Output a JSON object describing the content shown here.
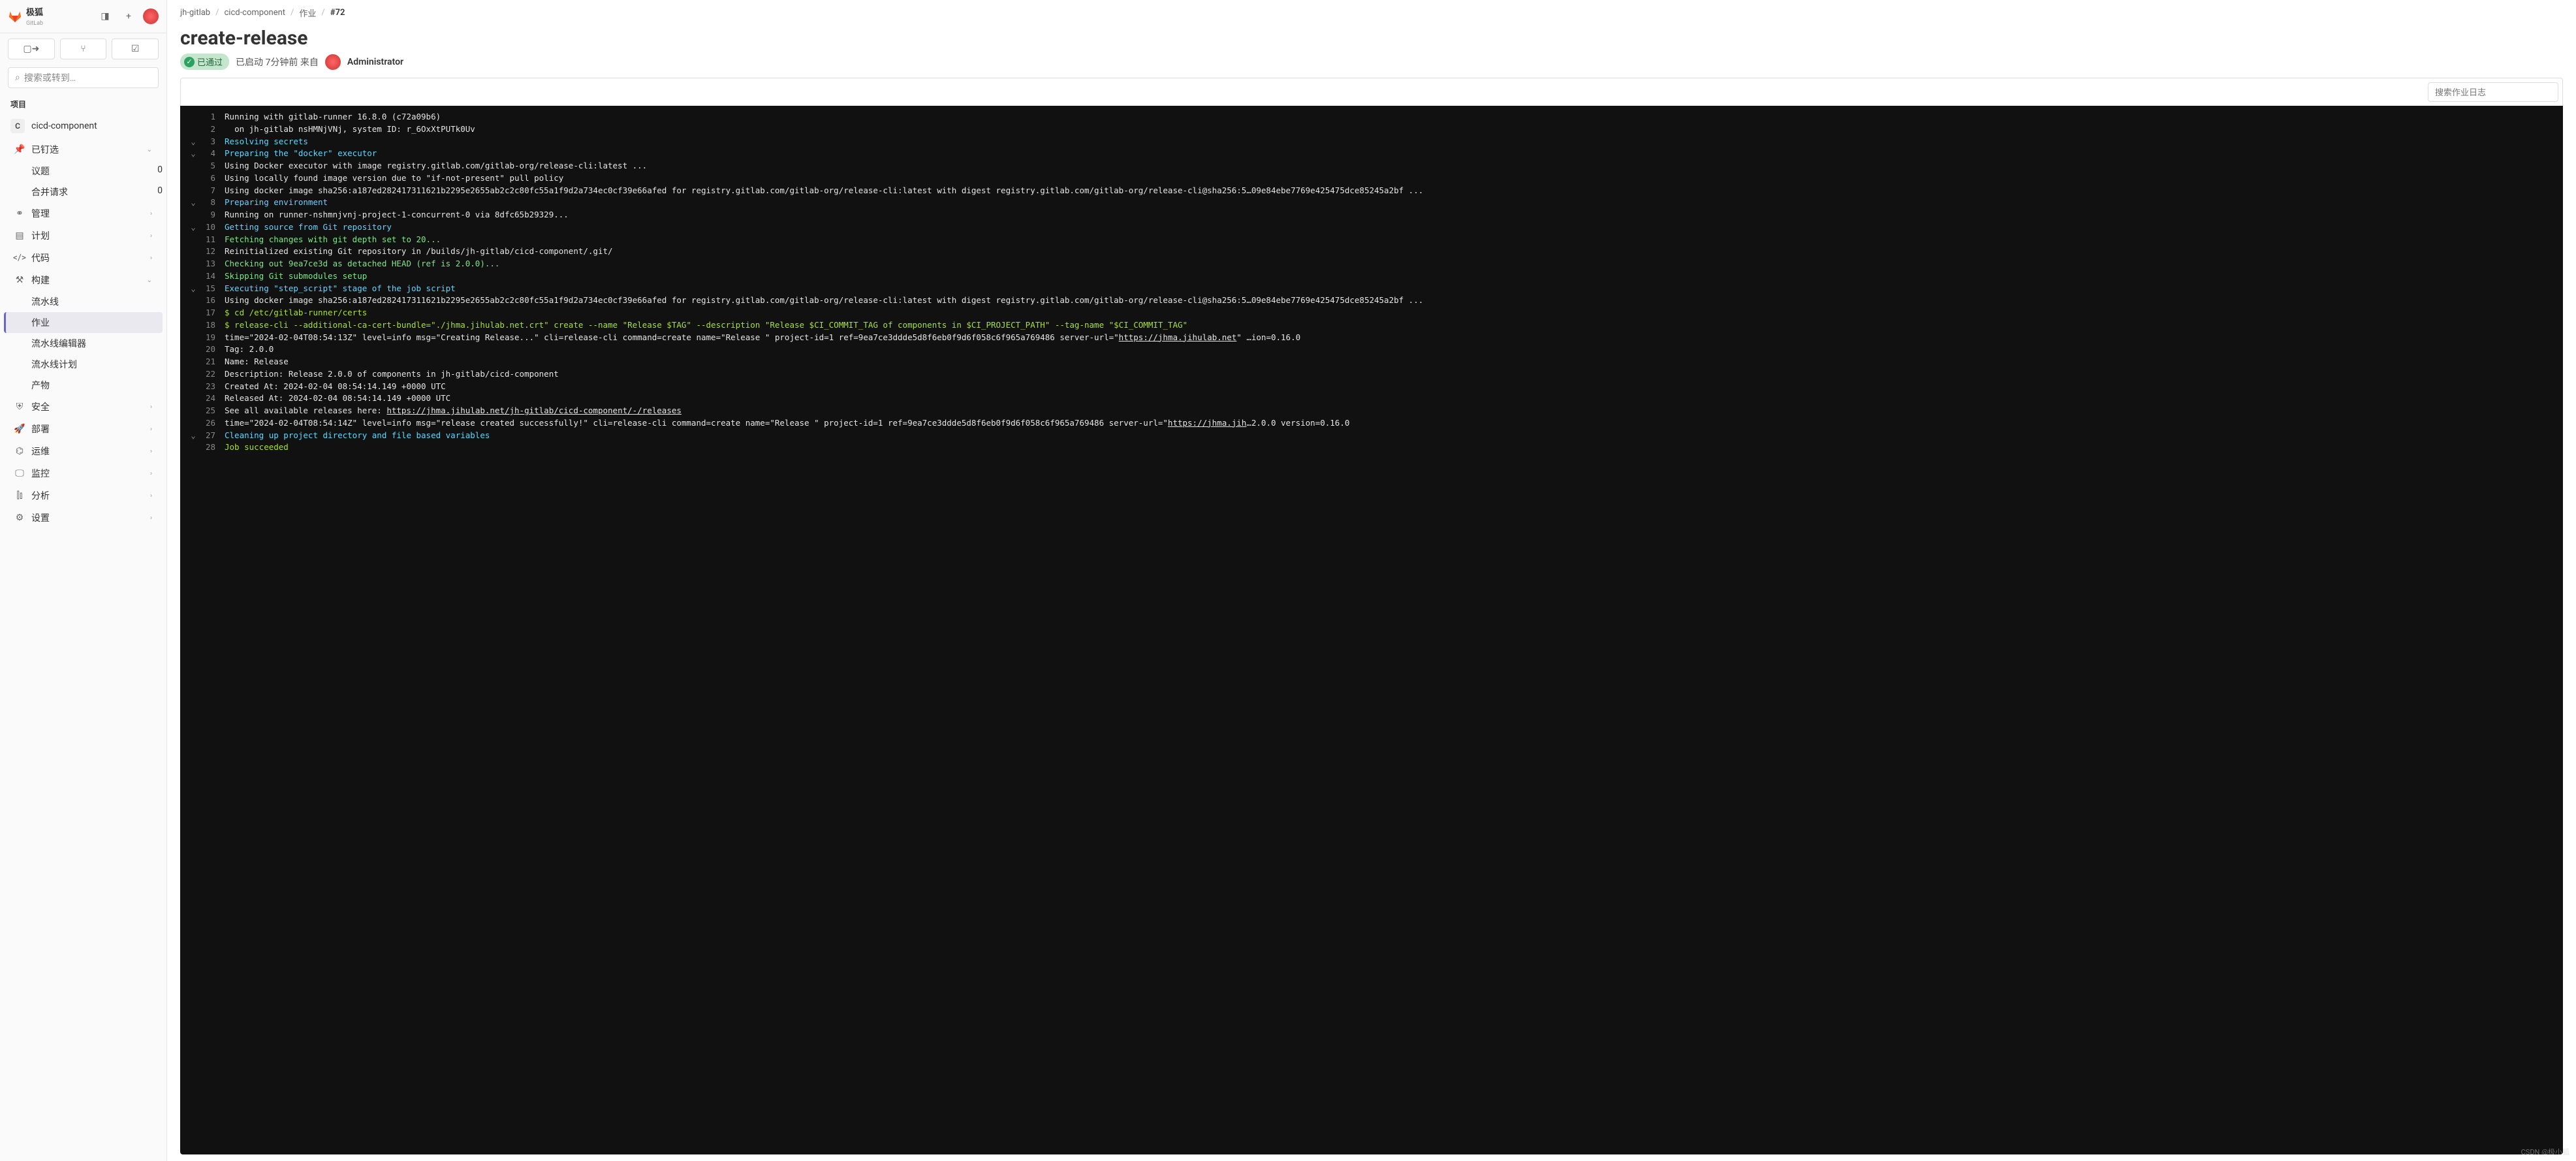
{
  "brand": {
    "name": "极狐",
    "sub": "GitLab"
  },
  "search_placeholder": "搜索或转到…",
  "section_label": "项目",
  "project": {
    "initial": "C",
    "name": "cicd-component"
  },
  "sidebar": {
    "pinned": "已钉选",
    "issues": "议题",
    "issues_count": "0",
    "mrs": "合并请求",
    "mrs_count": "0",
    "manage": "管理",
    "plan": "计划",
    "code": "代码",
    "build": "构建",
    "build_subs": [
      "流水线",
      "作业",
      "流水线编辑器",
      "流水线计划",
      "产物"
    ],
    "security": "安全",
    "deploy": "部署",
    "operate": "运维",
    "monitor": "监控",
    "analytics": "分析",
    "settings": "设置"
  },
  "breadcrumb": [
    "jh-gitlab",
    "cicd-component",
    "作业",
    "#72"
  ],
  "title": "create-release",
  "status": "已通过",
  "meta_launched": "已启动 7分钟前 来自",
  "user": "Administrator",
  "log_search_placeholder": "搜索作业日志",
  "watermark": "CSDN @极小狐",
  "log": [
    {
      "n": 1,
      "c": "",
      "t": "Running with gitlab-runner 16.8.0 (c72a09b6)",
      "cls": "c-white"
    },
    {
      "n": 2,
      "c": "",
      "t": "  on jh-gitlab nsHMNjVNj, system ID: r_6OxXtPUTk0Uv",
      "cls": "c-white"
    },
    {
      "n": 3,
      "c": "v",
      "t": "Resolving secrets",
      "cls": "c-cyan"
    },
    {
      "n": 4,
      "c": "v",
      "t": "Preparing the \"docker\" executor",
      "cls": "c-cyan"
    },
    {
      "n": 5,
      "c": "",
      "t": "Using Docker executor with image registry.gitlab.com/gitlab-org/release-cli:latest ...",
      "cls": "c-white"
    },
    {
      "n": 6,
      "c": "",
      "t": "Using locally found image version due to \"if-not-present\" pull policy",
      "cls": "c-white"
    },
    {
      "n": 7,
      "c": "",
      "t": "Using docker image sha256:a187ed282417311621b2295e2655ab2c2c80fc55a1f9d2a734ec0cf39e66afed for registry.gitlab.com/gitlab-org/release-cli:latest with digest registry.gitlab.com/gitlab-org/release-cli@sha256:5…09e84ebe7769e425475dce85245a2bf ...",
      "cls": "c-white"
    },
    {
      "n": 8,
      "c": "v",
      "t": "Preparing environment",
      "cls": "c-cyan"
    },
    {
      "n": 9,
      "c": "",
      "t": "Running on runner-nshmnjvnj-project-1-concurrent-0 via 8dfc65b29329...",
      "cls": "c-white"
    },
    {
      "n": 10,
      "c": "v",
      "t": "Getting source from Git repository",
      "cls": "c-cyan"
    },
    {
      "n": 11,
      "c": "",
      "t": "Fetching changes with git depth set to 20...",
      "cls": "c-green"
    },
    {
      "n": 12,
      "c": "",
      "t": "Reinitialized existing Git repository in /builds/jh-gitlab/cicd-component/.git/",
      "cls": "c-white"
    },
    {
      "n": 13,
      "c": "",
      "t": "Checking out 9ea7ce3d as detached HEAD (ref is 2.0.0)...",
      "cls": "c-green"
    },
    {
      "n": 14,
      "c": "",
      "t": "Skipping Git submodules setup",
      "cls": "c-green"
    },
    {
      "n": 15,
      "c": "v",
      "t": "Executing \"step_script\" stage of the job script",
      "cls": "c-cyan"
    },
    {
      "n": 16,
      "c": "",
      "t": "Using docker image sha256:a187ed282417311621b2295e2655ab2c2c80fc55a1f9d2a734ec0cf39e66afed for registry.gitlab.com/gitlab-org/release-cli:latest with digest registry.gitlab.com/gitlab-org/release-cli@sha256:5…09e84ebe7769e425475dce85245a2bf ...",
      "cls": "c-white"
    },
    {
      "n": 17,
      "c": "",
      "t": "$ cd /etc/gitlab-runner/certs",
      "cls": "c-lime"
    },
    {
      "n": 18,
      "c": "",
      "t": "$ release-cli --additional-ca-cert-bundle=\"./jhma.jihulab.net.crt\" create --name \"Release $TAG\" --description \"Release $CI_COMMIT_TAG of components in $CI_PROJECT_PATH\" --tag-name \"$CI_COMMIT_TAG\"",
      "cls": "c-lime"
    },
    {
      "n": 19,
      "c": "",
      "t": "time=\"2024-02-04T08:54:13Z\" level=info msg=\"Creating Release...\" cli=release-cli command=create name=\"Release \" project-id=1 ref=9ea7ce3ddde5d8f6eb0f9d6f058c6f965a769486 server-url=\"https://jhma.jihulab.net\" …ion=0.16.0",
      "cls": "c-white",
      "link": "https://jhma.jihulab.net"
    },
    {
      "n": 20,
      "c": "",
      "t": "Tag: 2.0.0",
      "cls": "c-white"
    },
    {
      "n": 21,
      "c": "",
      "t": "Name: Release",
      "cls": "c-white"
    },
    {
      "n": 22,
      "c": "",
      "t": "Description: Release 2.0.0 of components in jh-gitlab/cicd-component",
      "cls": "c-white"
    },
    {
      "n": 23,
      "c": "",
      "t": "Created At: 2024-02-04 08:54:14.149 +0000 UTC",
      "cls": "c-white"
    },
    {
      "n": 24,
      "c": "",
      "t": "Released At: 2024-02-04 08:54:14.149 +0000 UTC",
      "cls": "c-white"
    },
    {
      "n": 25,
      "c": "",
      "t": "See all available releases here: https://jhma.jihulab.net/jh-gitlab/cicd-component/-/releases",
      "cls": "c-white",
      "link": "https://jhma.jihulab.net/jh-gitlab/cicd-component/-/releases"
    },
    {
      "n": 26,
      "c": "",
      "t": "time=\"2024-02-04T08:54:14Z\" level=info msg=\"release created successfully!\" cli=release-cli command=create name=\"Release \" project-id=1 ref=9ea7ce3ddde5d8f6eb0f9d6f058c6f965a769486 server-url=\"https://jhma.jih…2.0.0 version=0.16.0",
      "cls": "c-white",
      "link": "https://jhma.jih"
    },
    {
      "n": 27,
      "c": "v",
      "t": "Cleaning up project directory and file based variables",
      "cls": "c-cyan"
    },
    {
      "n": 28,
      "c": "",
      "t": "Job succeeded",
      "cls": "c-lime"
    }
  ]
}
